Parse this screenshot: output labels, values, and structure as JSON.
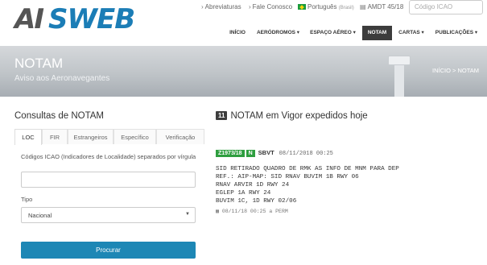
{
  "header": {
    "logo_left": "AI",
    "logo_right": "SWEB",
    "utility": {
      "abbreviations": "Abreviaturas",
      "contact": "Fale Conosco",
      "language": "Português",
      "language_note": "(Brasil)",
      "amdt": "AMDT 45/18",
      "search_placeholder": "Código ICAO"
    },
    "nav": [
      {
        "label": "INÍCIO"
      },
      {
        "label": "AERÓDROMOS ▾"
      },
      {
        "label": "ESPAÇO AÉREO ▾"
      },
      {
        "label": "NOTAM"
      },
      {
        "label": "CARTAS ▾"
      },
      {
        "label": "PUBLICAÇÕES ▾"
      }
    ]
  },
  "banner": {
    "title": "NOTAM",
    "subtitle": "Aviso aos Aeronavegantes",
    "breadcrumb": "INÍCIO  >  NOTAM"
  },
  "left_panel": {
    "title": "Consultas de NOTAM",
    "tabs": [
      "LOC",
      "FIR",
      "Estrangeiros",
      "Específico",
      "Verificação"
    ],
    "icao_label": "Códigos ICAO (Indicadores de Localidade) separados por vírgula",
    "icao_value": "",
    "type_label": "Tipo",
    "type_selected": "Nacional",
    "submit_label": "Procurar"
  },
  "right_panel": {
    "count": "11",
    "title": "NOTAM em Vigor expedidos hoje",
    "notam": {
      "id": "Z1973/18",
      "series": "N",
      "location": "SBVT",
      "date": "08/11/2018 00:25",
      "lines": [
        "SID RETIRADO QUADRO DE RMK AS INFO DE MNM PARA DEP",
        "REF.: AIP-MAP: SID RNAV BUVIM 1B RWY 06",
        "RNAV ARVIR 1D RWY 24",
        "EGLEP 1A RWY 24",
        "BUVIM 1C, 1D RWY 02/06"
      ],
      "validity": "08/11/18 00:25 a PERM"
    }
  },
  "icons": {
    "abbreviations": "chevron-right-icon",
    "contact": "chevron-right-icon",
    "amdt": "document-icon",
    "validity": "calendar-icon"
  }
}
